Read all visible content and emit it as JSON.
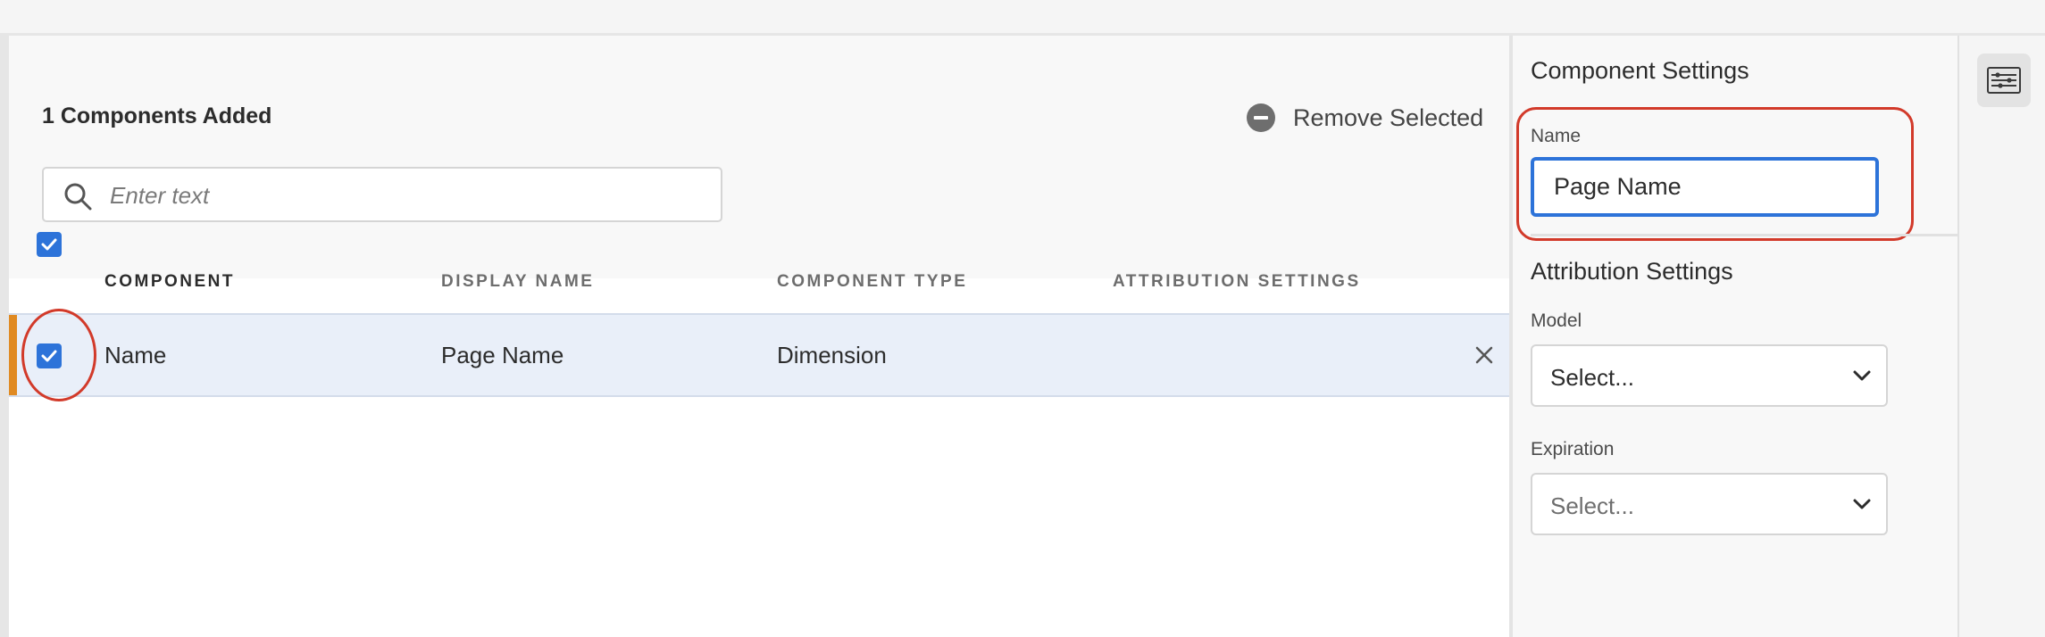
{
  "header": {
    "components_added": "1 Components Added",
    "remove_selected": "Remove Selected"
  },
  "search": {
    "placeholder": "Enter text",
    "value": ""
  },
  "table": {
    "columns": [
      "COMPONENT",
      "DISPLAY NAME",
      "COMPONENT TYPE",
      "ATTRIBUTION SETTINGS"
    ],
    "rows": [
      {
        "component": "Name",
        "display_name": "Page Name",
        "component_type": "Dimension",
        "attribution_settings": "",
        "selected": true
      }
    ]
  },
  "panel": {
    "title": "Component Settings",
    "name_label": "Name",
    "name_value": "Page Name",
    "attribution_title": "Attribution Settings",
    "model_label": "Model",
    "model_value": "Select...",
    "expiration_label": "Expiration",
    "expiration_value": "Select..."
  },
  "icons": [
    "minus-circle-icon",
    "search-icon",
    "checkbox-icon",
    "close-icon",
    "chevron-down-icon",
    "sliders-icon"
  ],
  "colors": {
    "accent": "#2d73d9",
    "row_highlight": "#e9eff9",
    "row_accent": "#e08a22",
    "annotation": "#d23a2a"
  }
}
